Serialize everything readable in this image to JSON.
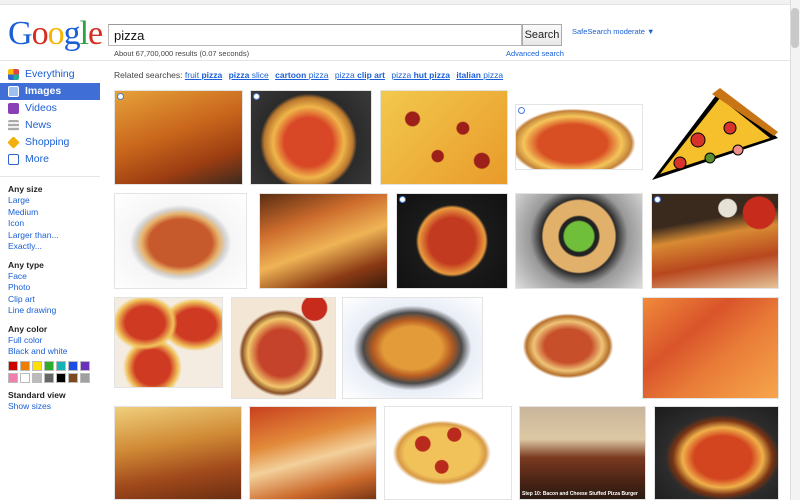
{
  "logo": {
    "text": "Google"
  },
  "search": {
    "query": "pizza",
    "button": "Search"
  },
  "safesearch": "SafeSearch moderate ▼",
  "results_stats": "About 67,700,000 results (0.07 seconds)",
  "advanced_search": "Advanced search",
  "related": {
    "label": "Related searches:",
    "links": [
      {
        "prefix": "fruit",
        "term": "pizza"
      },
      {
        "prefix": "pizza",
        "term": "slice"
      },
      {
        "prefix": "cartoon",
        "term": "pizza"
      },
      {
        "prefix": "pizza",
        "term": "clip art"
      },
      {
        "prefix": "pizza",
        "term": "hut pizza"
      },
      {
        "prefix": "italian",
        "term": "pizza"
      }
    ]
  },
  "nav": [
    {
      "label": "Everything",
      "icon": "everything-icon",
      "color": "#d44"
    },
    {
      "label": "Images",
      "icon": "images-icon",
      "color": "#7aa9e6"
    },
    {
      "label": "Videos",
      "icon": "videos-icon",
      "color": "#8b3fb6"
    },
    {
      "label": "News",
      "icon": "news-icon",
      "color": "#999"
    },
    {
      "label": "Shopping",
      "icon": "shopping-icon",
      "color": "#f2b10a"
    },
    {
      "label": "More",
      "icon": "more-icon",
      "color": "#2f63c9"
    }
  ],
  "filters": {
    "size": {
      "heading": "Any size",
      "options": [
        "Large",
        "Medium",
        "Icon",
        "Larger than...",
        "Exactly..."
      ]
    },
    "type": {
      "heading": "Any type",
      "options": [
        "Face",
        "Photo",
        "Clip art",
        "Line drawing"
      ]
    },
    "color": {
      "heading": "Any color",
      "options": [
        "Full color",
        "Black and white"
      ]
    },
    "view": {
      "heading": "Standard view",
      "options": [
        "Show sizes"
      ]
    }
  },
  "swatches": [
    "#cc0000",
    "#f07c00",
    "#ffe100",
    "#2cae2c",
    "#15b3b3",
    "#1d4ee3",
    "#6d2fbf",
    "#f07fb0",
    "#ffffff",
    "#bbbbbb",
    "#666666",
    "#000000",
    "#7b4a21",
    "#a0a0a0"
  ],
  "image_captions": [
    "Step 10: Bacon and Cheese Stuffed Pizza Burger"
  ]
}
